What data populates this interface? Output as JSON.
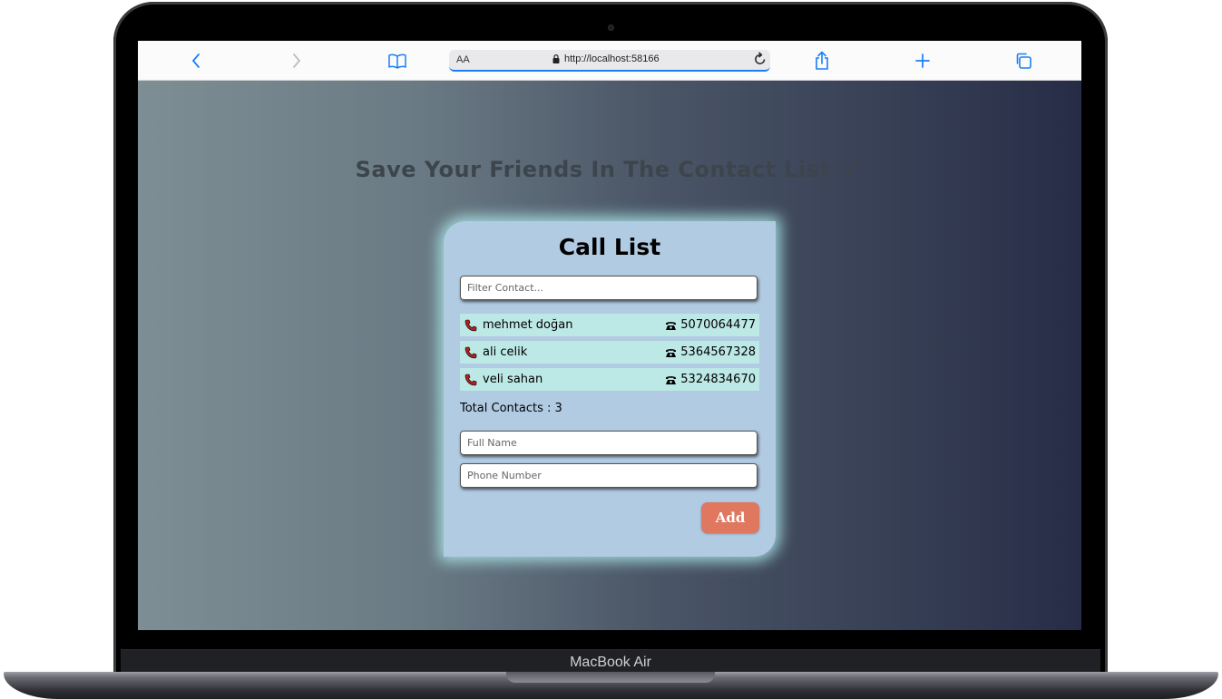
{
  "device": {
    "label": "MacBook Air"
  },
  "browser": {
    "text_size_label": "AA",
    "url": "http://localhost:58166",
    "icons": {
      "back": "chevron-left-icon",
      "forward": "chevron-right-icon",
      "bookmarks": "book-icon",
      "lock": "lock-icon",
      "reload": "reload-icon",
      "share": "share-icon",
      "new_tab": "plus-icon",
      "tabs": "tabs-icon"
    },
    "accent_color": "#1a7ef5"
  },
  "page": {
    "heading": "Save Your Friends In The Contact List",
    "heading_icon": "pencil-icon",
    "card": {
      "title": "Call List",
      "filter_placeholder": "Filter Contact...",
      "contacts": [
        {
          "name": "mehmet doğan",
          "phone": "5070064477"
        },
        {
          "name": "ali celik",
          "phone": "5364567328"
        },
        {
          "name": "veli sahan",
          "phone": "5324834670"
        }
      ],
      "total_label": "Total Contacts : 3",
      "full_name_placeholder": "Full Name",
      "phone_placeholder": "Phone Number",
      "add_label": "Add",
      "colors": {
        "card_bg": "#b1cbe2",
        "row_bg": "#bce8e6",
        "glow": "#afeeee",
        "add_button": "#df785f",
        "phone_icon": "#b22222"
      }
    }
  }
}
